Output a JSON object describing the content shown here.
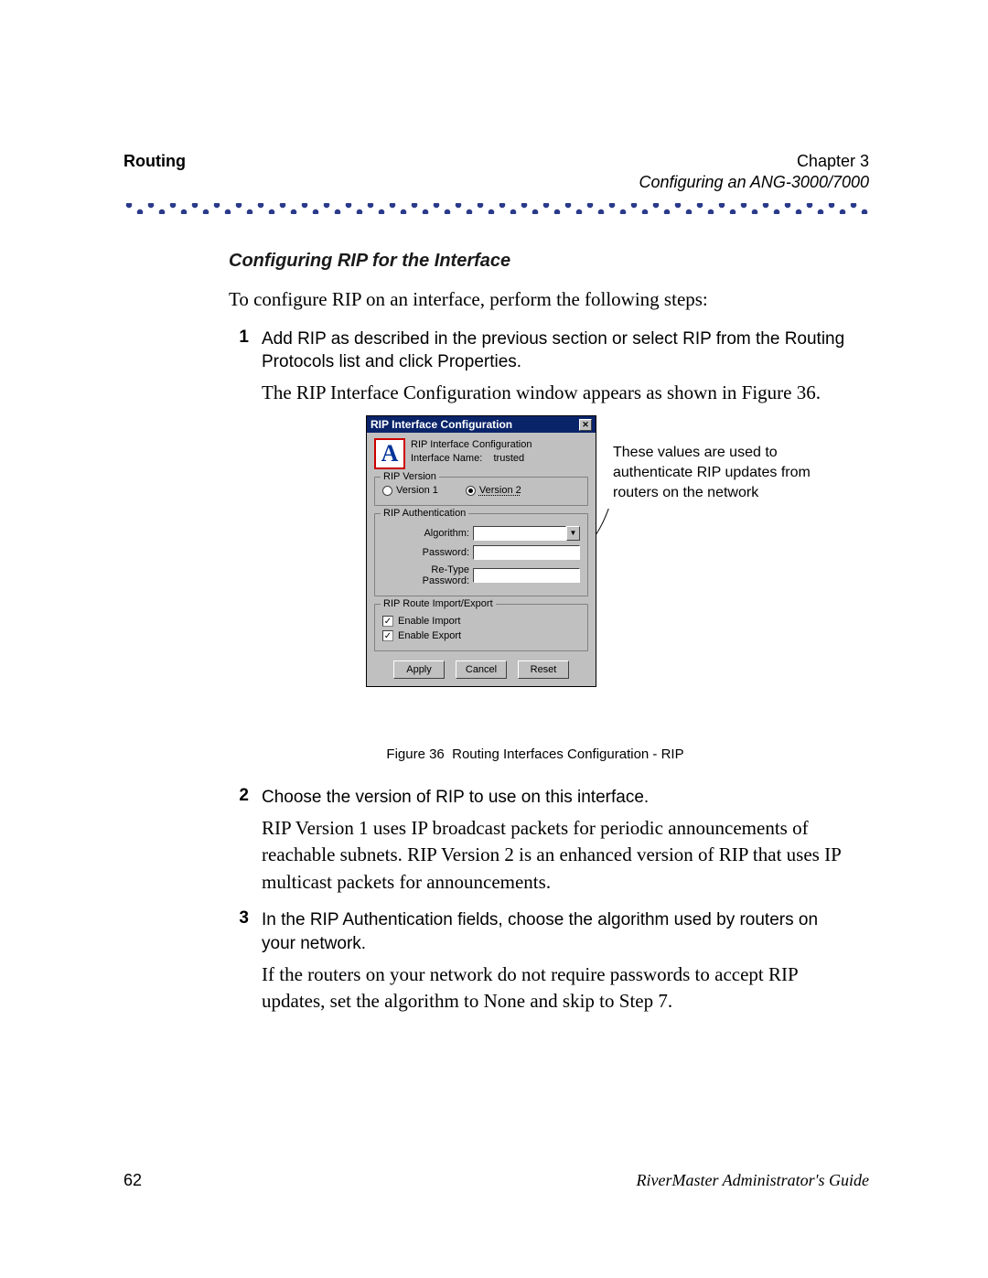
{
  "header": {
    "left": "Routing",
    "right_top": "Chapter 3",
    "right_sub": "Configuring an ANG-3000/7000"
  },
  "section_title": "Configuring RIP for the Interface",
  "intro": "To configure RIP on an interface, perform the following steps:",
  "steps": [
    {
      "num": "1",
      "instr": "Add RIP as described in the previous section or select RIP from the Routing Protocols list and click Properties.",
      "desc": "The RIP Interface Configuration window appears as shown in Figure 36."
    },
    {
      "num": "2",
      "instr": "Choose the version of RIP to use on this interface.",
      "desc": "RIP Version 1 uses IP broadcast packets for periodic announcements of reachable subnets. RIP Version 2 is an enhanced version of RIP that uses IP multicast packets for announcements."
    },
    {
      "num": "3",
      "instr": "In the RIP Authentication fields, choose the algorithm used by routers on your network.",
      "desc": "If the routers on your network do not require passwords to accept RIP updates, set the algorithm to None and skip to Step 7."
    }
  ],
  "dialog": {
    "title": "RIP Interface Configuration",
    "logo_letter": "A",
    "top_line1": "RIP Interface Configuration",
    "top_label": "Interface Name:",
    "top_value": "trusted",
    "group_version": "RIP Version",
    "radio_v1": "Version 1",
    "radio_v2": "Version 2",
    "group_auth": "RIP Authentication",
    "lbl_algorithm": "Algorithm:",
    "lbl_password": "Password:",
    "lbl_retype": "Re-Type Password:",
    "group_route": "RIP Route Import/Export",
    "chk_import": "Enable Import",
    "chk_export": "Enable Export",
    "btn_apply": "Apply",
    "btn_cancel": "Cancel",
    "btn_reset": "Reset",
    "close_glyph": "✕"
  },
  "callout": "These values are used to authenticate RIP updates from routers on the network",
  "figure": {
    "num": "Figure 36",
    "caption": "Routing Interfaces Configuration - RIP"
  },
  "footer": {
    "page": "62",
    "guide": "RiverMaster Administrator's Guide"
  },
  "checkmark": "✓",
  "combo_arrow": "▼"
}
